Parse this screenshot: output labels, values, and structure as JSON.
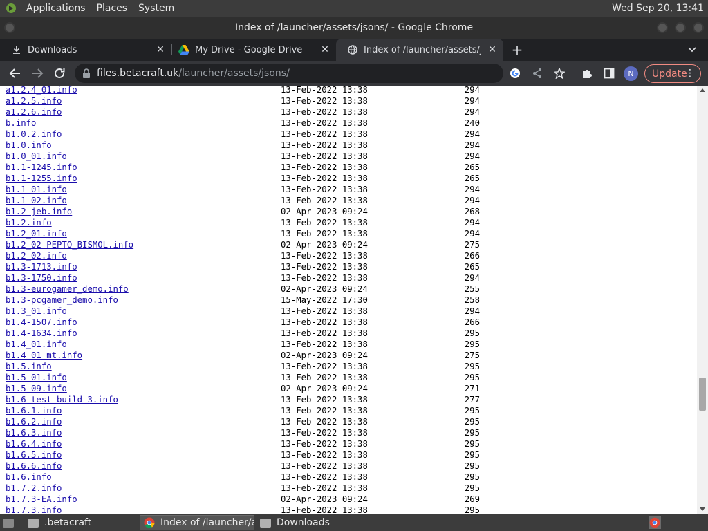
{
  "topbar": {
    "applications": "Applications",
    "places": "Places",
    "system": "System",
    "clock": "Wed Sep 20, 13:41"
  },
  "window": {
    "title": "Index of /launcher/assets/jsons/ - Google Chrome"
  },
  "tabs": [
    {
      "label": "Downloads",
      "icon": "download-icon"
    },
    {
      "label": "My Drive - Google Drive",
      "icon": "google-drive-icon"
    },
    {
      "label": "Index of /launcher/assets/jsons",
      "icon": "globe-icon"
    }
  ],
  "address": {
    "host": "files.betacraft.uk",
    "path": "/launcher/assets/jsons/"
  },
  "profile": {
    "initial": "N"
  },
  "update_label": "Update",
  "listing": [
    {
      "name": "a1.2.4_01.info",
      "date": "13-Feb-2022 13:38",
      "size": "294"
    },
    {
      "name": "a1.2.5.info",
      "date": "13-Feb-2022 13:38",
      "size": "294"
    },
    {
      "name": "a1.2.6.info",
      "date": "13-Feb-2022 13:38",
      "size": "294"
    },
    {
      "name": "b.info",
      "date": "13-Feb-2022 13:38",
      "size": "240"
    },
    {
      "name": "b1.0.2.info",
      "date": "13-Feb-2022 13:38",
      "size": "294"
    },
    {
      "name": "b1.0.info",
      "date": "13-Feb-2022 13:38",
      "size": "294"
    },
    {
      "name": "b1.0_01.info",
      "date": "13-Feb-2022 13:38",
      "size": "294"
    },
    {
      "name": "b1.1-1245.info",
      "date": "13-Feb-2022 13:38",
      "size": "265"
    },
    {
      "name": "b1.1-1255.info",
      "date": "13-Feb-2022 13:38",
      "size": "265"
    },
    {
      "name": "b1.1_01.info",
      "date": "13-Feb-2022 13:38",
      "size": "294"
    },
    {
      "name": "b1.1_02.info",
      "date": "13-Feb-2022 13:38",
      "size": "294"
    },
    {
      "name": "b1.2-jeb.info",
      "date": "02-Apr-2023 09:24",
      "size": "268"
    },
    {
      "name": "b1.2.info",
      "date": "13-Feb-2022 13:38",
      "size": "294"
    },
    {
      "name": "b1.2_01.info",
      "date": "13-Feb-2022 13:38",
      "size": "294"
    },
    {
      "name": "b1.2_02-PEPTO_BISMOL.info",
      "date": "02-Apr-2023 09:24",
      "size": "275"
    },
    {
      "name": "b1.2_02.info",
      "date": "13-Feb-2022 13:38",
      "size": "266"
    },
    {
      "name": "b1.3-1713.info",
      "date": "13-Feb-2022 13:38",
      "size": "265"
    },
    {
      "name": "b1.3-1750.info",
      "date": "13-Feb-2022 13:38",
      "size": "294"
    },
    {
      "name": "b1.3-eurogamer_demo.info",
      "date": "02-Apr-2023 09:24",
      "size": "255"
    },
    {
      "name": "b1.3-pcgamer_demo.info",
      "date": "15-May-2022 17:30",
      "size": "258"
    },
    {
      "name": "b1.3_01.info",
      "date": "13-Feb-2022 13:38",
      "size": "294"
    },
    {
      "name": "b1.4-1507.info",
      "date": "13-Feb-2022 13:38",
      "size": "266"
    },
    {
      "name": "b1.4-1634.info",
      "date": "13-Feb-2022 13:38",
      "size": "295"
    },
    {
      "name": "b1.4_01.info",
      "date": "13-Feb-2022 13:38",
      "size": "295"
    },
    {
      "name": "b1.4_01_mt.info",
      "date": "02-Apr-2023 09:24",
      "size": "275"
    },
    {
      "name": "b1.5.info",
      "date": "13-Feb-2022 13:38",
      "size": "295"
    },
    {
      "name": "b1.5_01.info",
      "date": "13-Feb-2022 13:38",
      "size": "295"
    },
    {
      "name": "b1.5_09.info",
      "date": "02-Apr-2023 09:24",
      "size": "271"
    },
    {
      "name": "b1.6-test_build_3.info",
      "date": "13-Feb-2022 13:38",
      "size": "277"
    },
    {
      "name": "b1.6.1.info",
      "date": "13-Feb-2022 13:38",
      "size": "295"
    },
    {
      "name": "b1.6.2.info",
      "date": "13-Feb-2022 13:38",
      "size": "295"
    },
    {
      "name": "b1.6.3.info",
      "date": "13-Feb-2022 13:38",
      "size": "295"
    },
    {
      "name": "b1.6.4.info",
      "date": "13-Feb-2022 13:38",
      "size": "295"
    },
    {
      "name": "b1.6.5.info",
      "date": "13-Feb-2022 13:38",
      "size": "295"
    },
    {
      "name": "b1.6.6.info",
      "date": "13-Feb-2022 13:38",
      "size": "295"
    },
    {
      "name": "b1.6.info",
      "date": "13-Feb-2022 13:38",
      "size": "295"
    },
    {
      "name": "b1.7.2.info",
      "date": "13-Feb-2022 13:38",
      "size": "295"
    },
    {
      "name": "b1.7.3-EA.info",
      "date": "02-Apr-2023 09:24",
      "size": "269"
    },
    {
      "name": "b1.7.3.info",
      "date": "13-Feb-2022 13:38",
      "size": "295"
    }
  ],
  "taskbar": [
    {
      "label": ".betacraft",
      "icon": "folder-icon"
    },
    {
      "label": "Index of /launcher/a...",
      "icon": "chrome-icon"
    },
    {
      "label": "Downloads",
      "icon": "folder-icon"
    }
  ]
}
